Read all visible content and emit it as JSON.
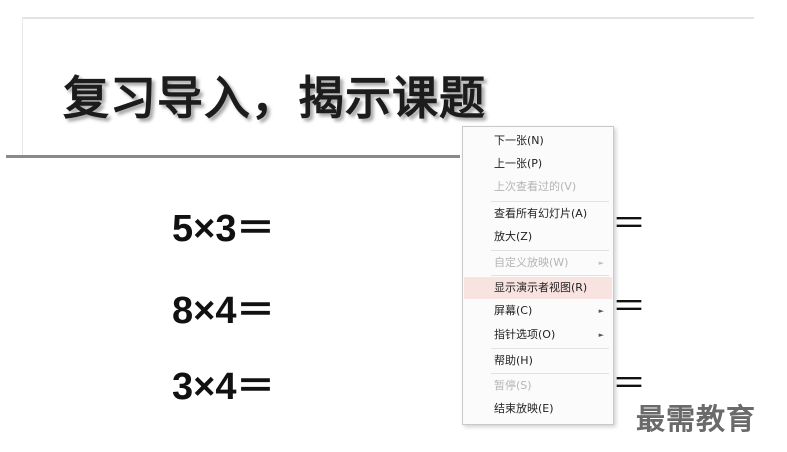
{
  "slide": {
    "title": "复习导入，揭示课题",
    "equations": [
      "5×3＝",
      "8×4＝",
      "3×4＝"
    ],
    "right_equals": [
      "＝",
      "＝",
      "＝"
    ]
  },
  "context_menu": {
    "items": [
      {
        "label": "下一张(N)",
        "disabled": false
      },
      {
        "label": "上一张(P)",
        "disabled": false
      },
      {
        "label": "上次查看过的(V)",
        "disabled": true
      },
      {
        "label": "查看所有幻灯片(A)",
        "disabled": false
      },
      {
        "label": "放大(Z)",
        "disabled": false
      },
      {
        "label": "自定义放映(W)",
        "disabled": true,
        "submenu": true
      },
      {
        "label": "显示演示者视图(R)",
        "disabled": false,
        "highlighted": true
      },
      {
        "label": "屏幕(C)",
        "disabled": false,
        "submenu": true
      },
      {
        "label": "指针选项(O)",
        "disabled": false,
        "submenu": true
      },
      {
        "label": "帮助(H)",
        "disabled": false
      },
      {
        "label": "暂停(S)",
        "disabled": true
      },
      {
        "label": "结束放映(E)",
        "disabled": false
      }
    ],
    "submenu_glyph": "►",
    "highlight_color": "#f8e3e1"
  },
  "watermark": "最需教育"
}
